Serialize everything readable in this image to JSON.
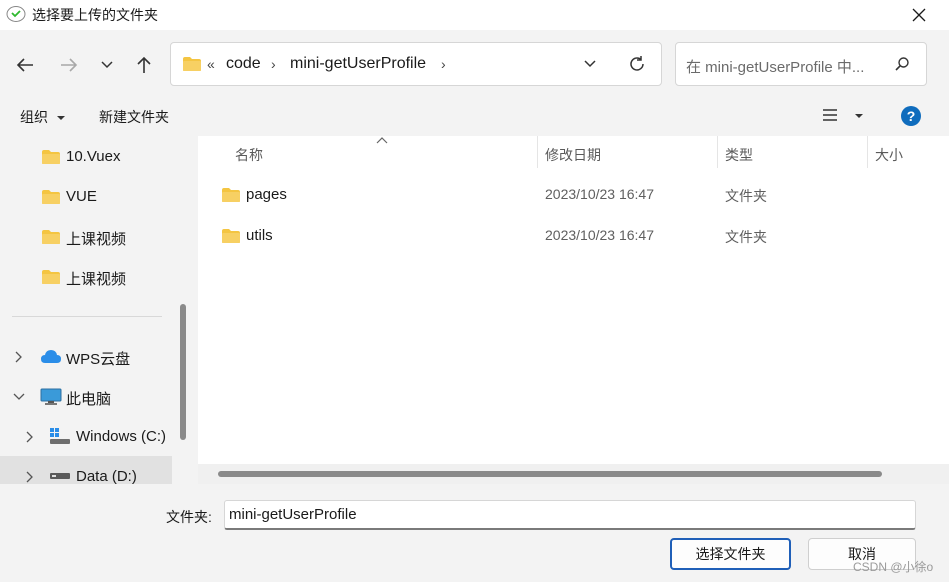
{
  "window": {
    "title": "选择要上传的文件夹"
  },
  "address": {
    "overflow": "«",
    "crumbs": [
      "code",
      "mini-getUserProfile"
    ]
  },
  "search": {
    "placeholder": "在 mini-getUserProfile 中..."
  },
  "toolbar": {
    "organize": "组织",
    "new_folder": "新建文件夹"
  },
  "sidebar": {
    "items": [
      {
        "label": "10.Vuex"
      },
      {
        "label": "VUE"
      },
      {
        "label": "上课视频"
      },
      {
        "label": "上课视频"
      },
      {
        "label": "WPS云盘"
      },
      {
        "label": "此电脑"
      },
      {
        "label": "Windows (C:)"
      },
      {
        "label": "Data (D:)"
      }
    ]
  },
  "columns": {
    "name": "名称",
    "modified": "修改日期",
    "type": "类型",
    "size": "大小"
  },
  "files": [
    {
      "name": "pages",
      "modified": "2023/10/23 16:47",
      "type": "文件夹"
    },
    {
      "name": "utils",
      "modified": "2023/10/23 16:47",
      "type": "文件夹"
    }
  ],
  "footer": {
    "folder_label": "文件夹:",
    "folder_value": "mini-getUserProfile",
    "select_button": "选择文件夹",
    "cancel_button": "取消"
  },
  "watermark": "CSDN @小徐o",
  "colors": {
    "folder": "#f4c542",
    "accent": "#1f5fb8",
    "help": "#0f6cbd"
  }
}
